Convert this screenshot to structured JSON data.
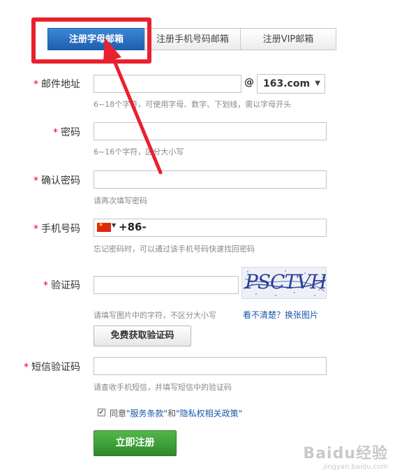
{
  "tabs": [
    {
      "label": "注册字母邮箱",
      "active": true
    },
    {
      "label": "注册手机号码邮箱",
      "active": false
    },
    {
      "label": "注册VIP邮箱",
      "active": false
    }
  ],
  "form": {
    "required_mark": "*",
    "email": {
      "label": "邮件地址",
      "value": "",
      "at": "@",
      "domain": "163.com",
      "hint": "6~18个字符，可使用字母、数字、下划线，需以字母开头"
    },
    "password": {
      "label": "密码",
      "value": "",
      "hint": "6~16个字符，区分大小写"
    },
    "confirm_password": {
      "label": "确认密码",
      "value": "",
      "hint": "请再次填写密码"
    },
    "phone": {
      "label": "手机号码",
      "prefix": "+86-",
      "value": "",
      "hint": "忘记密码时，可以通过该手机号码快速找回密码"
    },
    "captcha": {
      "label": "验证码",
      "value": "",
      "image_text": "PSCTVH",
      "hint": "请填写图片中的字符，不区分大小写",
      "refresh_link": "看不清楚？换张图片",
      "get_code_button": "免费获取验证码"
    },
    "sms_code": {
      "label": "短信验证码",
      "value": "",
      "hint": "请查收手机短信，并填写短信中的验证码"
    },
    "agreement": {
      "checked": true,
      "prefix": "同意",
      "terms": "\"服务条款\"",
      "and": "和",
      "privacy": "\"隐私权相关政策\""
    },
    "submit_button": "立即注册"
  },
  "watermark": {
    "brand": "Baidu经验",
    "url": "jingyan.baidu.com"
  },
  "colors": {
    "active_tab": "#2a6fc4",
    "required": "#e60012",
    "link": "#1a58a6",
    "submit": "#3f9e37",
    "annotation": "#e8212e"
  }
}
